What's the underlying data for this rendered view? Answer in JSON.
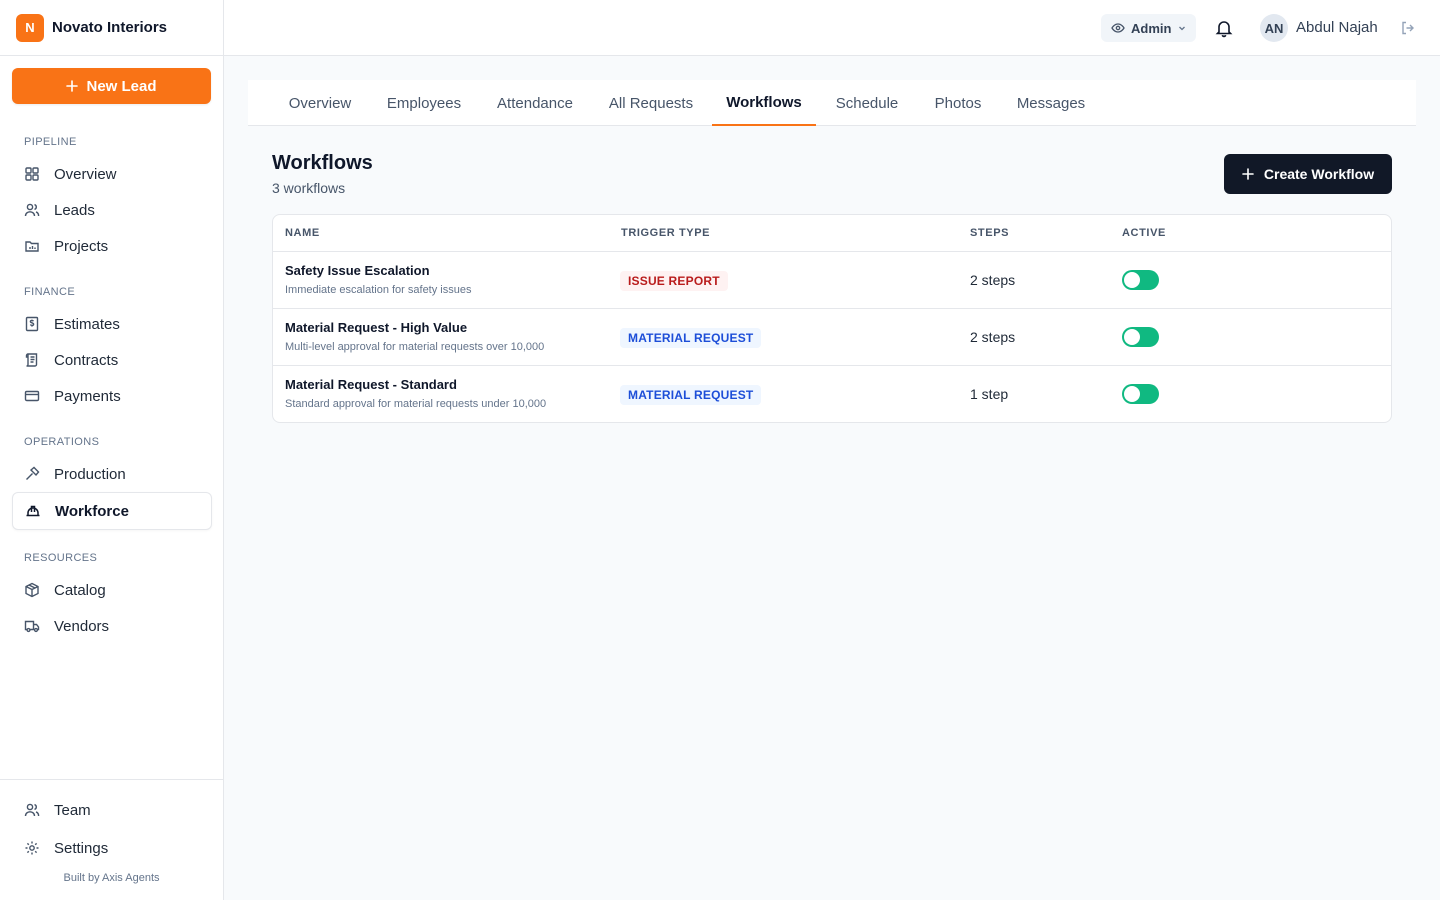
{
  "brand": {
    "initial": "N",
    "name": "Novato Interiors"
  },
  "sidebar": {
    "new_lead_label": "New Lead",
    "sections": [
      {
        "heading": "PIPELINE",
        "items": [
          {
            "label": "Overview",
            "icon": "grid-icon"
          },
          {
            "label": "Leads",
            "icon": "users-icon"
          },
          {
            "label": "Projects",
            "icon": "folder-chart-icon"
          }
        ]
      },
      {
        "heading": "FINANCE",
        "items": [
          {
            "label": "Estimates",
            "icon": "receipt-dollar-icon"
          },
          {
            "label": "Contracts",
            "icon": "scroll-icon"
          },
          {
            "label": "Payments",
            "icon": "credit-card-icon"
          }
        ]
      },
      {
        "heading": "OPERATIONS",
        "items": [
          {
            "label": "Production",
            "icon": "hammer-icon"
          },
          {
            "label": "Workforce",
            "icon": "hard-hat-icon",
            "active": true
          }
        ]
      },
      {
        "heading": "RESOURCES",
        "items": [
          {
            "label": "Catalog",
            "icon": "package-icon"
          },
          {
            "label": "Vendors",
            "icon": "truck-icon"
          }
        ]
      }
    ],
    "footer": {
      "team_label": "Team",
      "settings_label": "Settings",
      "built_by": "Built by Axis Agents"
    }
  },
  "topbar": {
    "role": "Admin",
    "user_initials": "AN",
    "user_name": "Abdul Najah"
  },
  "tabs": [
    {
      "label": "Overview"
    },
    {
      "label": "Employees"
    },
    {
      "label": "Attendance"
    },
    {
      "label": "All Requests"
    },
    {
      "label": "Workflows",
      "active": true
    },
    {
      "label": "Schedule"
    },
    {
      "label": "Photos"
    },
    {
      "label": "Messages"
    }
  ],
  "page": {
    "title": "Workflows",
    "subtitle": "3 workflows",
    "create_label": "Create Workflow"
  },
  "table": {
    "columns": [
      "NAME",
      "TRIGGER TYPE",
      "STEPS",
      "ACTIVE"
    ],
    "rows": [
      {
        "name": "Safety Issue Escalation",
        "description": "Immediate escalation for safety issues",
        "trigger": "ISSUE REPORT",
        "trigger_color": "#b91c1c",
        "steps": "2 steps",
        "active": true
      },
      {
        "name": "Material Request - High Value",
        "description": "Multi-level approval for material requests over 10,000",
        "trigger": "MATERIAL REQUEST",
        "trigger_color": "#1d4ed8",
        "steps": "2 steps",
        "active": true
      },
      {
        "name": "Material Request - Standard",
        "description": "Standard approval for material requests under 10,000",
        "trigger": "MATERIAL REQUEST",
        "trigger_color": "#1d4ed8",
        "steps": "1 step",
        "active": true
      }
    ]
  },
  "colors": {
    "accent": "#f97316",
    "toggle_on": "#10b981",
    "dark_button": "#111827"
  }
}
